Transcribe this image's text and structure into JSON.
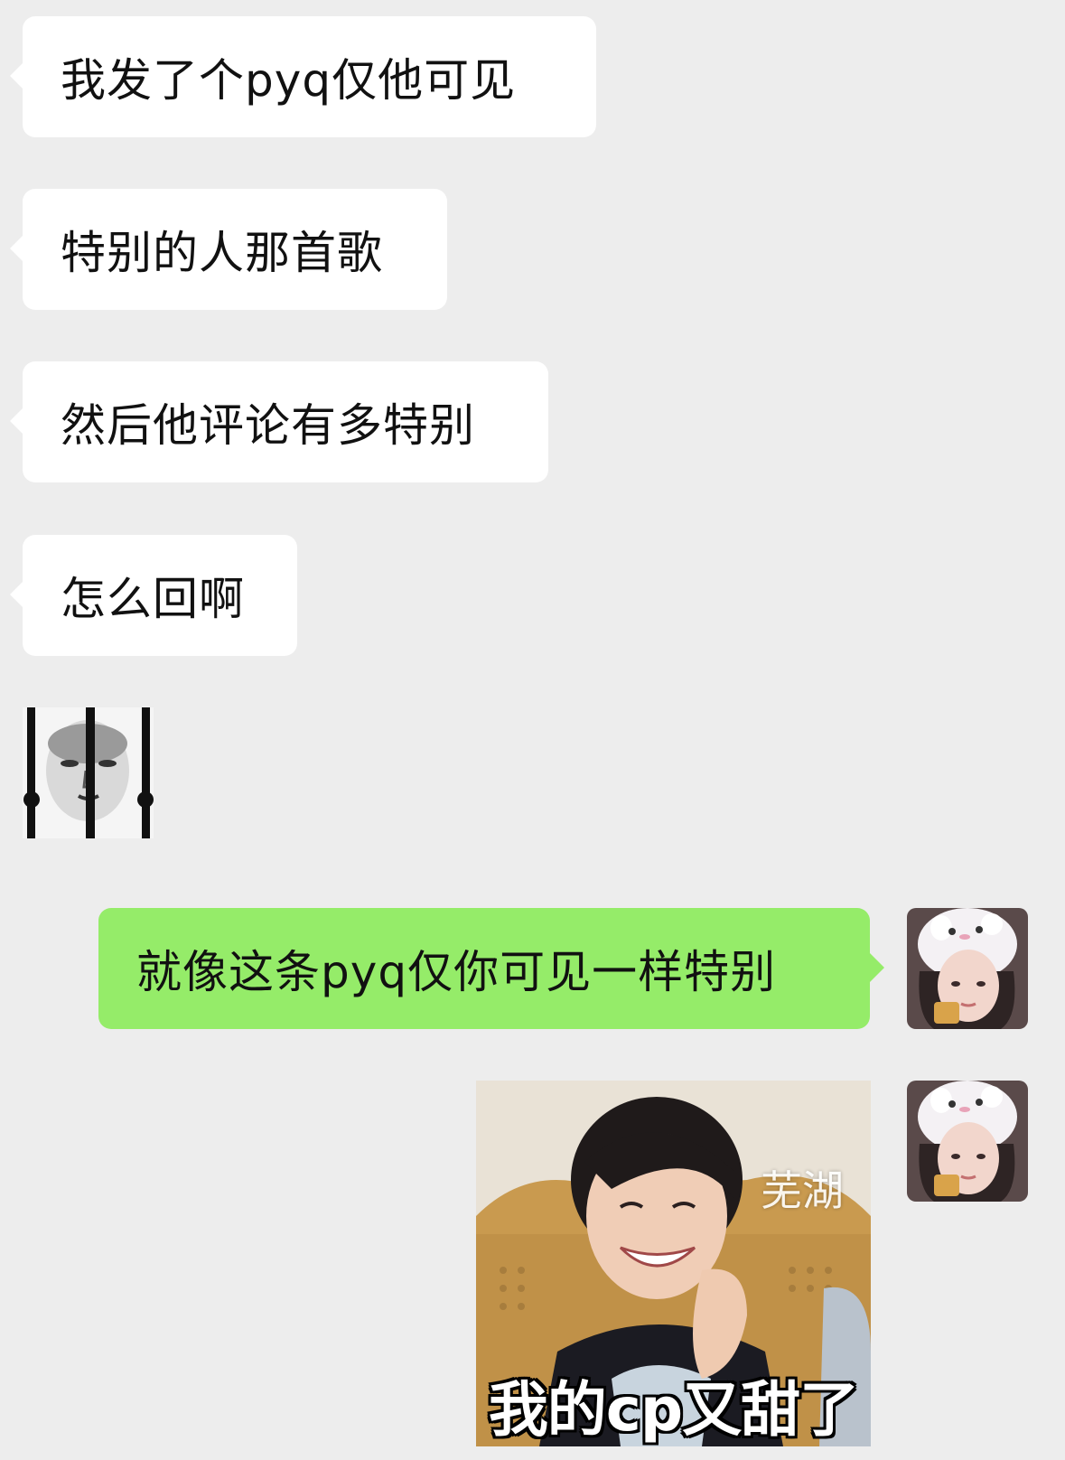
{
  "conversation": {
    "incoming": [
      {
        "text": "我发了个pyq仅他可见"
      },
      {
        "text": "特别的人那首歌"
      },
      {
        "text": "然后他评论有多特别"
      },
      {
        "text": "怎么回啊"
      }
    ],
    "incoming_sticker": {
      "icon": "jail-face-sticker"
    },
    "outgoing": [
      {
        "text": "就像这条pyq仅你可见一样特别"
      }
    ],
    "outgoing_sticker": {
      "caption": "我的cp又甜了",
      "watermark": "芜湖"
    }
  },
  "colors": {
    "background": "#ededed",
    "incoming_bubble": "#ffffff",
    "outgoing_bubble": "#95ec69"
  }
}
